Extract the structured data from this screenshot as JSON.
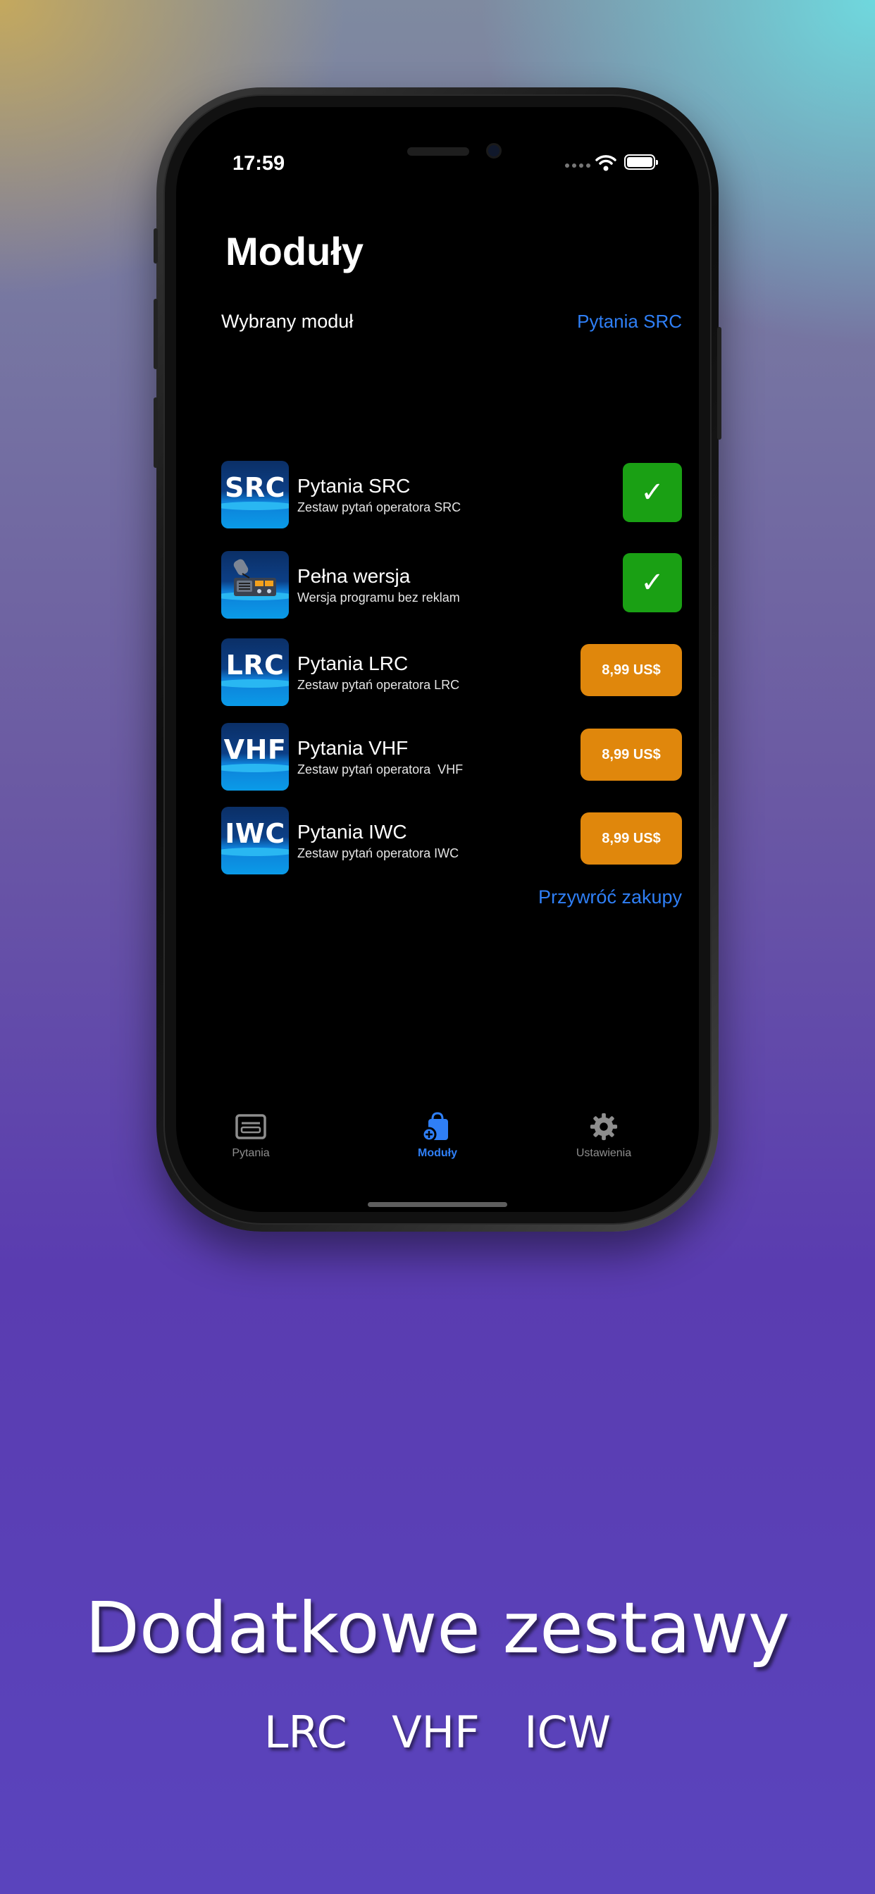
{
  "status_bar": {
    "time": "17:59"
  },
  "page_title": "Moduły",
  "selected": {
    "label": "Wybrany moduł",
    "value": "Pytania SRC"
  },
  "modules": [
    {
      "icon": "SRC",
      "title": "Pytania SRC",
      "subtitle": "Zestaw pytań operatora SRC",
      "state": "owned"
    },
    {
      "icon": "radio-icon",
      "title": "Pełna wersja",
      "subtitle": "Wersja programu bez reklam",
      "state": "owned"
    },
    {
      "icon": "LRC",
      "title": "Pytania LRC",
      "subtitle": "Zestaw pytań operatora LRC",
      "state": "price",
      "price": "8,99 US$"
    },
    {
      "icon": "VHF",
      "title": "Pytania VHF",
      "subtitle": "Zestaw pytań operatora  VHF",
      "state": "price",
      "price": "8,99 US$"
    },
    {
      "icon": "IWC",
      "title": "Pytania IWC",
      "subtitle": "Zestaw pytań operatora IWC",
      "state": "price",
      "price": "8,99 US$"
    }
  ],
  "check_glyph": "✓",
  "restore_link": "Przywróć zakupy",
  "tabs": [
    {
      "label": "Pytania",
      "icon": "questions-card-icon",
      "active": false
    },
    {
      "label": "Moduły",
      "icon": "shopping-bag-add-icon",
      "active": true
    },
    {
      "label": "Ustawienia",
      "icon": "gear-icon",
      "active": false
    }
  ],
  "colors": {
    "accent_blue": "#2f7ff6",
    "owned_green": "#1aa014",
    "price_orange": "#e0870c",
    "inactive_tab": "#8e8e8e"
  },
  "marketing": {
    "headline": "Dodatkowe zestawy",
    "subline": "LRC  VHF  ICW"
  }
}
